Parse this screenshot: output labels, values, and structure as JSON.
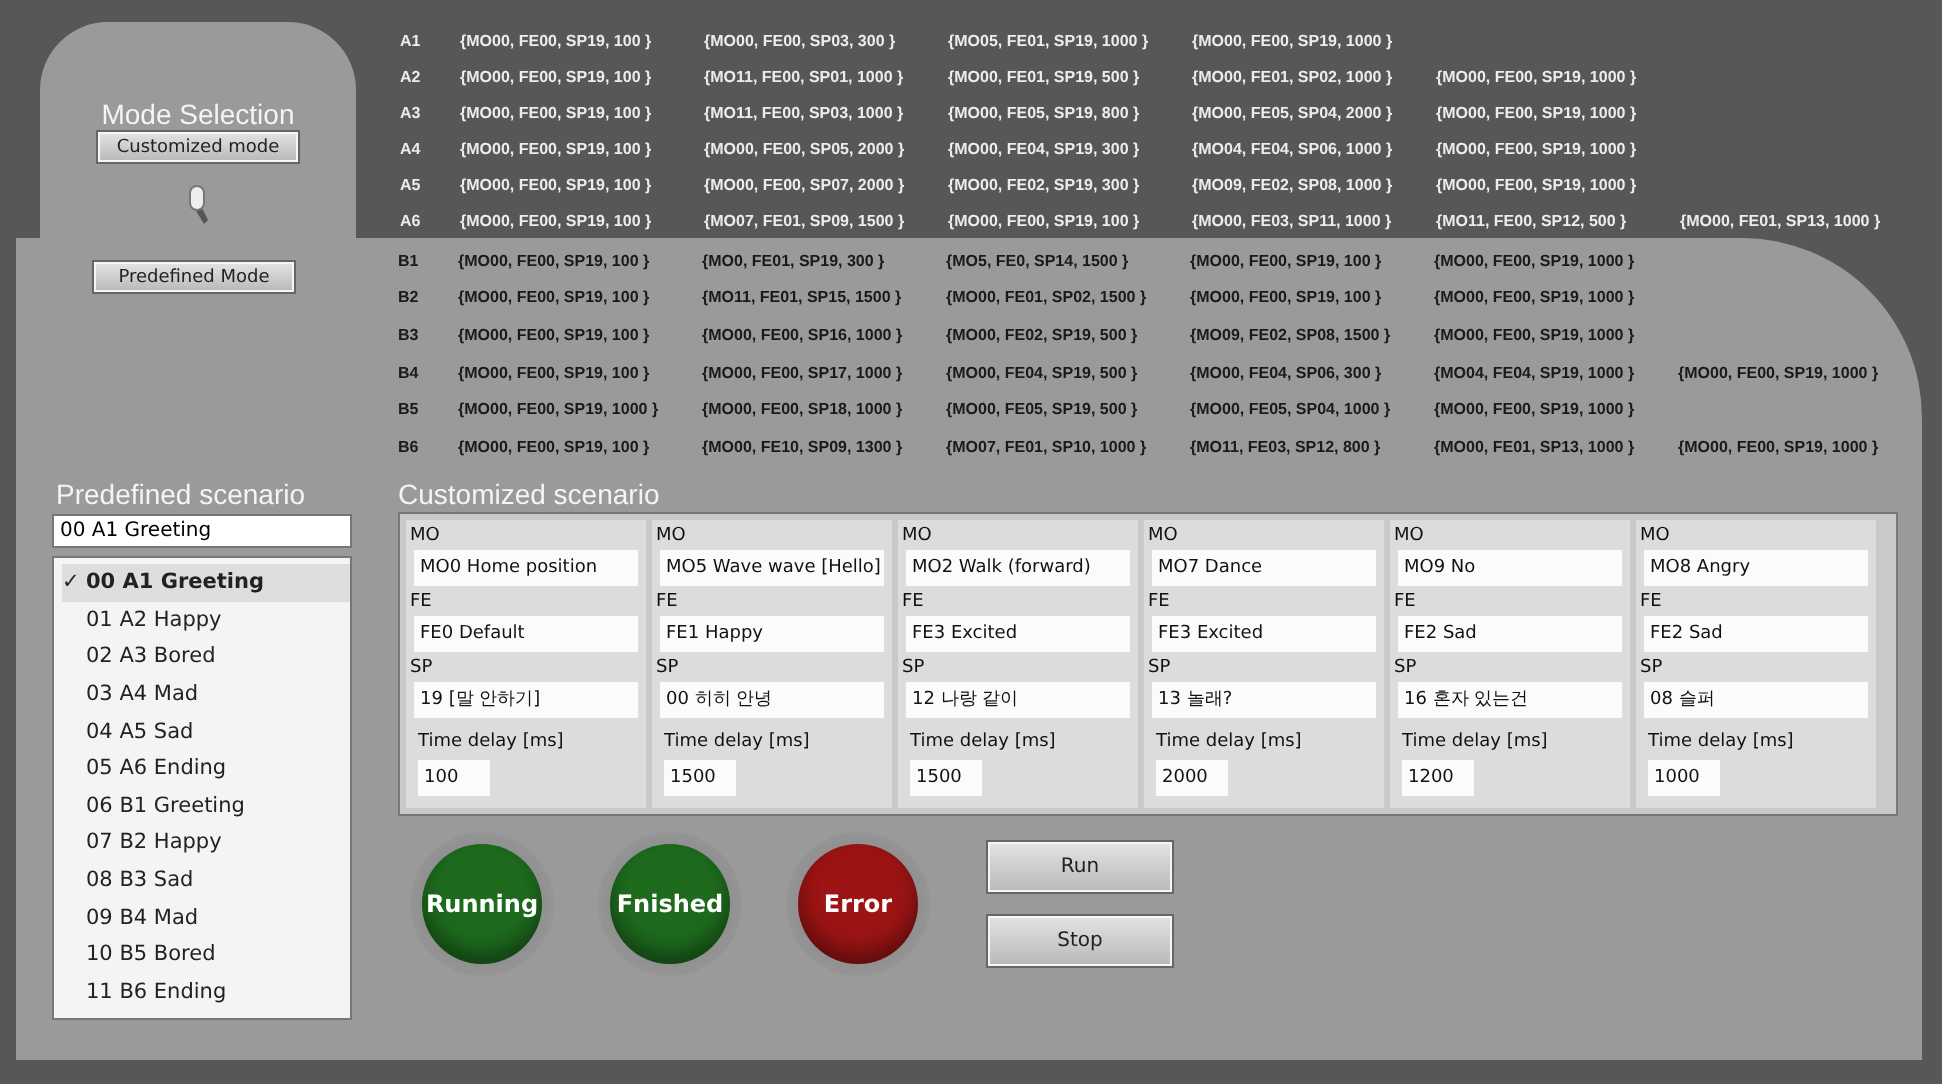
{
  "mode_selection": {
    "title": "Mode Selection",
    "buttons": [
      {
        "label": "Customized mode"
      },
      {
        "label": "Predefined Mode"
      }
    ]
  },
  "a_table": [
    {
      "label": "A1",
      "cells": [
        "{MO00, FE00, SP19, 100 }",
        "{MO00, FE00, SP03, 300 }",
        "{MO05, FE01, SP19, 1000 }",
        "{MO00, FE00, SP19, 1000 }"
      ]
    },
    {
      "label": "A2",
      "cells": [
        "{MO00, FE00, SP19, 100 }",
        "{MO11, FE00, SP01, 1000 }",
        "{MO00, FE01, SP19, 500 }",
        "{MO00, FE01, SP02, 1000 }",
        "{MO00, FE00, SP19, 1000 }"
      ]
    },
    {
      "label": "A3",
      "cells": [
        "{MO00, FE00, SP19, 100 }",
        "{MO11, FE00, SP03, 1000 }",
        "{MO00, FE05, SP19, 800 }",
        "{MO00, FE05, SP04, 2000 }",
        "{MO00, FE00, SP19, 1000 }"
      ]
    },
    {
      "label": "A4",
      "cells": [
        "{MO00, FE00, SP19, 100 }",
        "{MO00, FE00, SP05, 2000 }",
        "{MO00, FE04, SP19, 300 }",
        "{MO04, FE04, SP06, 1000 }",
        "{MO00, FE00, SP19, 1000 }"
      ]
    },
    {
      "label": "A5",
      "cells": [
        "{MO00, FE00, SP19, 100 }",
        "{MO00, FE00, SP07, 2000 }",
        "{MO00, FE02, SP19, 300 }",
        "{MO09, FE02, SP08, 1000 }",
        "{MO00, FE00, SP19, 1000 }"
      ]
    },
    {
      "label": "A6",
      "cells": [
        "{MO00, FE00, SP19, 100 }",
        "{MO07, FE01, SP09, 1500 }",
        "{MO00, FE00, SP19, 100 }",
        "{MO00, FE03, SP11, 1000 }",
        "{MO11, FE00, SP12, 500 }",
        "{MO00, FE01, SP13, 1000 }"
      ]
    }
  ],
  "b_table": [
    {
      "label": "B1",
      "cells": [
        "{MO00, FE00, SP19, 100 }",
        "{MO0, FE01, SP19, 300 }",
        "{MO5, FE0, SP14, 1500 }",
        "{MO00, FE00, SP19, 100 }",
        "{MO00, FE00, SP19, 1000 }"
      ]
    },
    {
      "label": "B2",
      "cells": [
        "{MO00, FE00, SP19, 100 }",
        "{MO11, FE01, SP15, 1500 }",
        "{MO00, FE01, SP02, 1500 }",
        "{MO00, FE00, SP19, 100 }",
        "{MO00, FE00, SP19, 1000 }"
      ]
    },
    {
      "label": "B3",
      "cells": [
        "{MO00, FE00, SP19, 100 }",
        "{MO00, FE00, SP16, 1000 }",
        "{MO00, FE02, SP19, 500 }",
        "{MO09, FE02, SP08, 1500 }",
        "{MO00, FE00, SP19, 1000 }"
      ]
    },
    {
      "label": "B4",
      "cells": [
        "{MO00, FE00, SP19, 100 }",
        "{MO00, FE00, SP17, 1000 }",
        "{MO00, FE04, SP19, 500 }",
        "{MO00, FE04, SP06, 300 }",
        "{MO04, FE04, SP19, 1000 }",
        "{MO00, FE00, SP19, 1000 }"
      ]
    },
    {
      "label": "B5",
      "cells": [
        "{MO00, FE00, SP19, 1000 }",
        "{MO00, FE00, SP18, 1000 }",
        "{MO00, FE05, SP19, 500 }",
        "{MO00, FE05, SP04, 1000 }",
        "{MO00, FE00, SP19, 1000 }"
      ]
    },
    {
      "label": "B6",
      "cells": [
        "{MO00, FE00, SP19, 100 }",
        "{MO00, FE10, SP09, 1300 }",
        "{MO07, FE01, SP10, 1000 }",
        "{MO11, FE03, SP12, 800 }",
        "{MO00, FE01, SP13, 1000 }",
        "{MO00, FE00, SP19, 1000 }"
      ]
    }
  ],
  "predefined": {
    "title": "Predefined scenario",
    "value": "00 A1 Greeting",
    "check": "✓",
    "items": [
      {
        "label": "00 A1 Greeting",
        "selected": true
      },
      {
        "label": "01 A2 Happy",
        "selected": false
      },
      {
        "label": "02 A3 Bored",
        "selected": false
      },
      {
        "label": "03 A4 Mad",
        "selected": false
      },
      {
        "label": "04 A5 Sad",
        "selected": false
      },
      {
        "label": "05 A6 Ending",
        "selected": false
      },
      {
        "label": "06 B1 Greeting",
        "selected": false
      },
      {
        "label": "07 B2 Happy",
        "selected": false
      },
      {
        "label": "08 B3 Sad",
        "selected": false
      },
      {
        "label": "09 B4 Mad",
        "selected": false
      },
      {
        "label": "10 B5 Bored",
        "selected": false
      },
      {
        "label": "11 B6 Ending",
        "selected": false
      }
    ]
  },
  "customized": {
    "title": "Customized scenario",
    "steps": [
      {
        "mo_label": "MO",
        "mo": "MO0 Home position",
        "fe_label": "FE",
        "fe": "FE0 Default",
        "sp_label": "SP",
        "sp": "19 [말 안하기]",
        "delay_label": "Time delay [ms]",
        "delay": "100"
      },
      {
        "mo_label": "MO",
        "mo": "MO5 Wave wave [Hello]",
        "fe_label": "FE",
        "fe": "FE1 Happy",
        "sp_label": "SP",
        "sp": "00 히히 안녕",
        "delay_label": "Time delay [ms]",
        "delay": "1500"
      },
      {
        "mo_label": "MO",
        "mo": "MO2 Walk (forward)",
        "fe_label": "FE",
        "fe": "FE3 Excited",
        "sp_label": "SP",
        "sp": "12 나랑 같이",
        "delay_label": "Time delay [ms]",
        "delay": "1500"
      },
      {
        "mo_label": "MO",
        "mo": "MO7 Dance",
        "fe_label": "FE",
        "fe": "FE3 Excited",
        "sp_label": "SP",
        "sp": "13 놀래?",
        "delay_label": "Time delay [ms]",
        "delay": "2000"
      },
      {
        "mo_label": "MO",
        "mo": "MO9 No",
        "fe_label": "FE",
        "fe": "FE2 Sad",
        "sp_label": "SP",
        "sp": "16 혼자 있는건",
        "delay_label": "Time delay [ms]",
        "delay": "1200"
      },
      {
        "mo_label": "MO",
        "mo": "MO8 Angry",
        "fe_label": "FE",
        "fe": "FE2 Sad",
        "sp_label": "SP",
        "sp": "08 슬퍼",
        "delay_label": "Time delay [ms]",
        "delay": "1000"
      }
    ]
  },
  "indicators": [
    {
      "label": "Running",
      "color": "#1e6b1e"
    },
    {
      "label": "Fnished",
      "color": "#1e6b1e"
    },
    {
      "label": "Error",
      "color": "#9c1414"
    }
  ],
  "buttons": [
    "Run",
    "Stop"
  ]
}
